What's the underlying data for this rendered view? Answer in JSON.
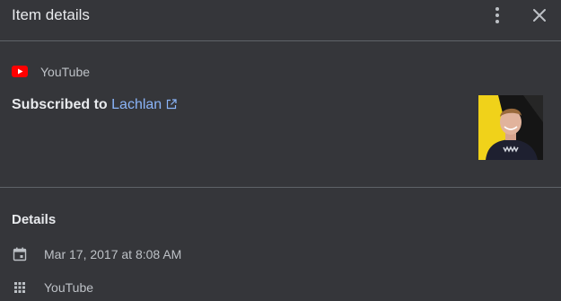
{
  "header": {
    "title": "Item details",
    "more_icon": "more-vert-icon",
    "close_icon": "close-icon"
  },
  "item": {
    "source": "YouTube",
    "source_icon": "youtube-logo-icon",
    "action": "Subscribed to",
    "channel": "Lachlan",
    "link_icon": "open-in-new-icon",
    "thumbnail": "channel-avatar"
  },
  "details": {
    "heading": "Details",
    "rows": [
      {
        "icon": "calendar-icon",
        "text": "Mar 17, 2017 at 8:08 AM"
      },
      {
        "icon": "apps-grid-icon",
        "text": "YouTube"
      }
    ]
  },
  "colors": {
    "background": "#35363a",
    "divider": "#5f6368",
    "link": "#8ab4f8",
    "youtube_red": "#ff0000",
    "text_primary": "#e8eaed",
    "text_secondary": "#bdc1c6"
  }
}
